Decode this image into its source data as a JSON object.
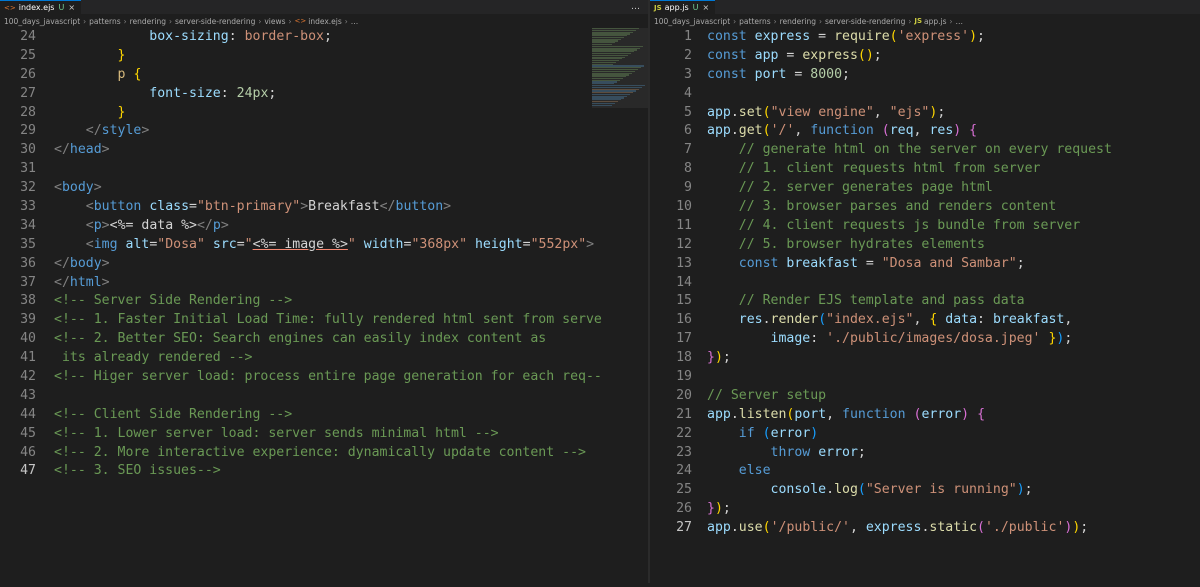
{
  "left": {
    "tab": {
      "icon": "ejs-file-icon",
      "name": "index.ejs",
      "status": "U",
      "close": "×"
    },
    "actions": "…",
    "breadcrumb": [
      "100_days_javascript",
      "patterns",
      "rendering",
      "server-side-rendering",
      "views",
      "index.ejs",
      "…"
    ],
    "lines": [
      {
        "n": "24",
        "segs": [
          [
            "pl",
            "            "
          ],
          [
            "prop",
            "box-sizing"
          ],
          [
            "pl",
            ": "
          ],
          [
            "cssv",
            "border-box"
          ],
          [
            "pl",
            ";"
          ]
        ]
      },
      {
        "n": "25",
        "segs": [
          [
            "pl",
            "        "
          ],
          [
            "yb",
            "}"
          ]
        ]
      },
      {
        "n": "26",
        "segs": [
          [
            "pl",
            "        "
          ],
          [
            "cls",
            "p"
          ],
          [
            "pl",
            " "
          ],
          [
            "yb",
            "{"
          ]
        ]
      },
      {
        "n": "27",
        "segs": [
          [
            "pl",
            "            "
          ],
          [
            "prop",
            "font-size"
          ],
          [
            "pl",
            ": "
          ],
          [
            "num",
            "24px"
          ],
          [
            "pl",
            ";"
          ]
        ]
      },
      {
        "n": "28",
        "segs": [
          [
            "pl",
            "        "
          ],
          [
            "yb",
            "}"
          ]
        ]
      },
      {
        "n": "29",
        "segs": [
          [
            "pl",
            "    "
          ],
          [
            "br",
            "</"
          ],
          [
            "tag",
            "style"
          ],
          [
            "br",
            ">"
          ]
        ]
      },
      {
        "n": "30",
        "segs": [
          [
            "br",
            "</"
          ],
          [
            "tag",
            "head"
          ],
          [
            "br",
            ">"
          ]
        ]
      },
      {
        "n": "31",
        "segs": []
      },
      {
        "n": "32",
        "segs": [
          [
            "br",
            "<"
          ],
          [
            "tag",
            "body"
          ],
          [
            "br",
            ">"
          ]
        ]
      },
      {
        "n": "33",
        "segs": [
          [
            "pl",
            "    "
          ],
          [
            "br",
            "<"
          ],
          [
            "tag",
            "button"
          ],
          [
            "pl",
            " "
          ],
          [
            "attr",
            "class"
          ],
          [
            "pl",
            "="
          ],
          [
            "str",
            "\"btn-primary\""
          ],
          [
            "br",
            ">"
          ],
          [
            "pl",
            "Breakfast"
          ],
          [
            "br",
            "</"
          ],
          [
            "tag",
            "button"
          ],
          [
            "br",
            ">"
          ]
        ]
      },
      {
        "n": "34",
        "segs": [
          [
            "pl",
            "    "
          ],
          [
            "br",
            "<"
          ],
          [
            "tag",
            "p"
          ],
          [
            "br",
            ">"
          ],
          [
            "ejs",
            "<%= data %>"
          ],
          [
            "br",
            "</"
          ],
          [
            "tag",
            "p"
          ],
          [
            "br",
            ">"
          ]
        ]
      },
      {
        "n": "35",
        "segs": [
          [
            "pl",
            "    "
          ],
          [
            "br",
            "<"
          ],
          [
            "tag",
            "img"
          ],
          [
            "pl",
            " "
          ],
          [
            "attr",
            "alt"
          ],
          [
            "pl",
            "="
          ],
          [
            "str",
            "\"Dosa\""
          ],
          [
            "pl",
            " "
          ],
          [
            "attr",
            "src"
          ],
          [
            "pl",
            "="
          ],
          [
            "str",
            "\""
          ],
          [
            "ejsu",
            "<%= image %>"
          ],
          [
            "str",
            "\""
          ],
          [
            "pl",
            " "
          ],
          [
            "attr",
            "width"
          ],
          [
            "pl",
            "="
          ],
          [
            "str",
            "\"368px\""
          ],
          [
            "pl",
            " "
          ],
          [
            "attr",
            "height"
          ],
          [
            "pl",
            "="
          ],
          [
            "str",
            "\"552px\""
          ],
          [
            "br",
            ">"
          ]
        ]
      },
      {
        "n": "36",
        "segs": [
          [
            "br",
            "</"
          ],
          [
            "tag",
            "body"
          ],
          [
            "br",
            ">"
          ]
        ]
      },
      {
        "n": "37",
        "segs": [
          [
            "br",
            "</"
          ],
          [
            "tag",
            "html"
          ],
          [
            "br",
            ">"
          ]
        ]
      },
      {
        "n": "38",
        "segs": [
          [
            "com",
            "<!-- Server Side Rendering -->"
          ]
        ]
      },
      {
        "n": "39",
        "segs": [
          [
            "com",
            "<!-- 1. Faster Initial Load Time: fully rendered html sent from serve"
          ]
        ]
      },
      {
        "n": "40",
        "segs": [
          [
            "com",
            "<!-- 2. Better SEO: Search engines can easily index content as"
          ]
        ]
      },
      {
        "n": "41",
        "segs": [
          [
            "com",
            " its already rendered -->"
          ]
        ]
      },
      {
        "n": "42",
        "segs": [
          [
            "com",
            "<!-- Higer server load: process entire page generation for each req--"
          ]
        ]
      },
      {
        "n": "43",
        "segs": []
      },
      {
        "n": "44",
        "segs": [
          [
            "com",
            "<!-- Client Side Rendering -->"
          ]
        ]
      },
      {
        "n": "45",
        "segs": [
          [
            "com",
            "<!-- 1. Lower server load: server sends minimal html -->"
          ]
        ]
      },
      {
        "n": "46",
        "segs": [
          [
            "com",
            "<!-- 2. More interactive experience: dynamically update content -->"
          ]
        ]
      },
      {
        "n": "47",
        "segs": [
          [
            "com",
            "<!-- 3. SEO issues-->"
          ]
        ],
        "current": true
      }
    ]
  },
  "right": {
    "tab": {
      "icon": "js-file-icon",
      "name": "app.js",
      "status": "U",
      "close": "×"
    },
    "breadcrumb": [
      "100_days_javascript",
      "patterns",
      "rendering",
      "server-side-rendering",
      "app.js",
      "…"
    ],
    "lines": [
      {
        "n": "1",
        "segs": [
          [
            "kw",
            "const"
          ],
          [
            "pl",
            " "
          ],
          [
            "var",
            "express"
          ],
          [
            "pl",
            " = "
          ],
          [
            "fn",
            "require"
          ],
          [
            "yb",
            "("
          ],
          [
            "str",
            "'express'"
          ],
          [
            "yb",
            ")"
          ],
          [
            "pl",
            ";"
          ]
        ]
      },
      {
        "n": "2",
        "segs": [
          [
            "kw",
            "const"
          ],
          [
            "pl",
            " "
          ],
          [
            "var",
            "app"
          ],
          [
            "pl",
            " = "
          ],
          [
            "fn",
            "express"
          ],
          [
            "yb",
            "()"
          ],
          [
            "pl",
            ";"
          ]
        ]
      },
      {
        "n": "3",
        "segs": [
          [
            "kw",
            "const"
          ],
          [
            "pl",
            " "
          ],
          [
            "var",
            "port"
          ],
          [
            "pl",
            " = "
          ],
          [
            "num",
            "8000"
          ],
          [
            "pl",
            ";"
          ]
        ]
      },
      {
        "n": "4",
        "segs": []
      },
      {
        "n": "5",
        "segs": [
          [
            "var",
            "app"
          ],
          [
            "pl",
            "."
          ],
          [
            "fn",
            "set"
          ],
          [
            "yb",
            "("
          ],
          [
            "str",
            "\"view engine\""
          ],
          [
            "pl",
            ", "
          ],
          [
            "str",
            "\"ejs\""
          ],
          [
            "yb",
            ")"
          ],
          [
            "pl",
            ";"
          ]
        ]
      },
      {
        "n": "6",
        "segs": [
          [
            "var",
            "app"
          ],
          [
            "pl",
            "."
          ],
          [
            "fn",
            "get"
          ],
          [
            "yb",
            "("
          ],
          [
            "str",
            "'/'"
          ],
          [
            "pl",
            ", "
          ],
          [
            "kw",
            "function"
          ],
          [
            "pl",
            " "
          ],
          [
            "pb",
            "("
          ],
          [
            "var",
            "req"
          ],
          [
            "pl",
            ", "
          ],
          [
            "var",
            "res"
          ],
          [
            "pb",
            ")"
          ],
          [
            "pl",
            " "
          ],
          [
            "pb",
            "{"
          ]
        ]
      },
      {
        "n": "7",
        "segs": [
          [
            "pl",
            "    "
          ],
          [
            "com",
            "// generate html on the server on every request"
          ]
        ]
      },
      {
        "n": "8",
        "segs": [
          [
            "pl",
            "    "
          ],
          [
            "com",
            "// 1. client requests html from server"
          ]
        ]
      },
      {
        "n": "9",
        "segs": [
          [
            "pl",
            "    "
          ],
          [
            "com",
            "// 2. server generates page html"
          ]
        ]
      },
      {
        "n": "10",
        "segs": [
          [
            "pl",
            "    "
          ],
          [
            "com",
            "// 3. browser parses and renders content"
          ]
        ]
      },
      {
        "n": "11",
        "segs": [
          [
            "pl",
            "    "
          ],
          [
            "com",
            "// 4. client requests js bundle from server"
          ]
        ]
      },
      {
        "n": "12",
        "segs": [
          [
            "pl",
            "    "
          ],
          [
            "com",
            "// 5. browser hydrates elements"
          ]
        ]
      },
      {
        "n": "13",
        "segs": [
          [
            "pl",
            "    "
          ],
          [
            "kw",
            "const"
          ],
          [
            "pl",
            " "
          ],
          [
            "var",
            "breakfast"
          ],
          [
            "pl",
            " = "
          ],
          [
            "str",
            "\"Dosa and Sambar\""
          ],
          [
            "pl",
            ";"
          ]
        ]
      },
      {
        "n": "14",
        "segs": []
      },
      {
        "n": "15",
        "segs": [
          [
            "pl",
            "    "
          ],
          [
            "com",
            "// Render EJS template and pass data"
          ]
        ]
      },
      {
        "n": "16",
        "segs": [
          [
            "pl",
            "    "
          ],
          [
            "var",
            "res"
          ],
          [
            "pl",
            "."
          ],
          [
            "fn",
            "render"
          ],
          [
            "bb",
            "("
          ],
          [
            "str",
            "\"index.ejs\""
          ],
          [
            "pl",
            ", "
          ],
          [
            "yb",
            "{"
          ],
          [
            "pl",
            " "
          ],
          [
            "var",
            "data"
          ],
          [
            "pl",
            ": "
          ],
          [
            "var",
            "breakfast"
          ],
          [
            "pl",
            ","
          ]
        ]
      },
      {
        "n": "17",
        "segs": [
          [
            "pl",
            "        "
          ],
          [
            "var",
            "image"
          ],
          [
            "pl",
            ": "
          ],
          [
            "str",
            "'./public/images/dosa.jpeg'"
          ],
          [
            "pl",
            " "
          ],
          [
            "yb",
            "}"
          ],
          [
            "bb",
            ")"
          ],
          [
            "pl",
            ";"
          ]
        ]
      },
      {
        "n": "18",
        "segs": [
          [
            "pb",
            "}"
          ],
          [
            "yb",
            ")"
          ],
          [
            "pl",
            ";"
          ]
        ]
      },
      {
        "n": "19",
        "segs": []
      },
      {
        "n": "20",
        "segs": [
          [
            "com",
            "// Server setup"
          ]
        ]
      },
      {
        "n": "21",
        "segs": [
          [
            "var",
            "app"
          ],
          [
            "pl",
            "."
          ],
          [
            "fn",
            "listen"
          ],
          [
            "yb",
            "("
          ],
          [
            "var",
            "port"
          ],
          [
            "pl",
            ", "
          ],
          [
            "kw",
            "function"
          ],
          [
            "pl",
            " "
          ],
          [
            "pb",
            "("
          ],
          [
            "var",
            "error"
          ],
          [
            "pb",
            ")"
          ],
          [
            "pl",
            " "
          ],
          [
            "pb",
            "{"
          ]
        ]
      },
      {
        "n": "22",
        "segs": [
          [
            "pl",
            "    "
          ],
          [
            "kw",
            "if"
          ],
          [
            "pl",
            " "
          ],
          [
            "bb",
            "("
          ],
          [
            "var",
            "error"
          ],
          [
            "bb",
            ")"
          ]
        ]
      },
      {
        "n": "23",
        "segs": [
          [
            "pl",
            "        "
          ],
          [
            "kw",
            "throw"
          ],
          [
            "pl",
            " "
          ],
          [
            "var",
            "error"
          ],
          [
            "pl",
            ";"
          ]
        ]
      },
      {
        "n": "24",
        "segs": [
          [
            "pl",
            "    "
          ],
          [
            "kw",
            "else"
          ]
        ]
      },
      {
        "n": "25",
        "segs": [
          [
            "pl",
            "        "
          ],
          [
            "var",
            "console"
          ],
          [
            "pl",
            "."
          ],
          [
            "fn",
            "log"
          ],
          [
            "bb",
            "("
          ],
          [
            "str",
            "\"Server is running\""
          ],
          [
            "bb",
            ")"
          ],
          [
            "pl",
            ";"
          ]
        ]
      },
      {
        "n": "26",
        "segs": [
          [
            "pb",
            "}"
          ],
          [
            "yb",
            ")"
          ],
          [
            "pl",
            ";"
          ]
        ]
      },
      {
        "n": "27",
        "segs": [
          [
            "var",
            "app"
          ],
          [
            "pl",
            "."
          ],
          [
            "fn",
            "use"
          ],
          [
            "yb",
            "("
          ],
          [
            "str",
            "'/public/'"
          ],
          [
            "pl",
            ", "
          ],
          [
            "var",
            "express"
          ],
          [
            "pl",
            "."
          ],
          [
            "fn",
            "static"
          ],
          [
            "pb",
            "("
          ],
          [
            "str",
            "'./public'"
          ],
          [
            "pb",
            ")"
          ],
          [
            "yb",
            ")"
          ],
          [
            "pl",
            ";"
          ]
        ],
        "current": true
      }
    ]
  }
}
